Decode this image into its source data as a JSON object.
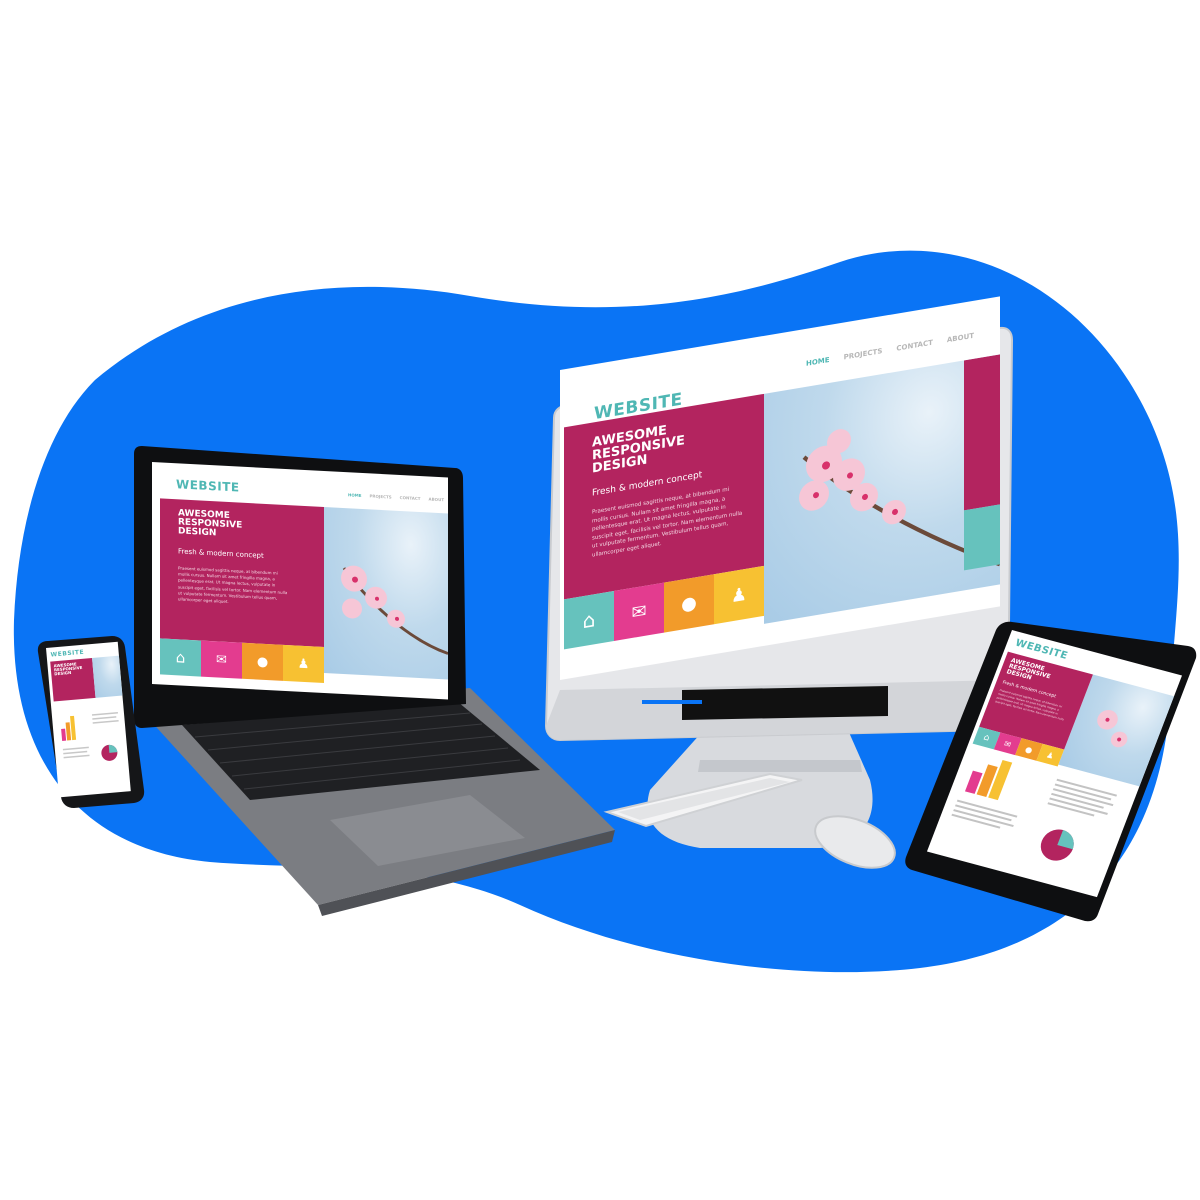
{
  "background": {
    "blob_color": "#0a74f5",
    "page_color": "#ffffff"
  },
  "website": {
    "brand": "WEBSITE",
    "nav": [
      "HOME",
      "PROJECTS",
      "CONTACT",
      "ABOUT"
    ],
    "headline_lines": [
      "AWESOME",
      "RESPONSIVE",
      "DESIGN"
    ],
    "tagline": "Fresh & modern concept",
    "body_lines": [
      "Praesent euismod sagittis neque, at bibendum mi",
      "mollis cursus. Nullam sit amet fringilla magna, a",
      "pellentesque erat. Ut magna lectus, vulputate in",
      "suscipit eget, facilisis vel tortor. Nam elementum nulla",
      "ut vulputate fermentum. Vestibulum tellus quam,",
      "ullamcorper eget aliquet."
    ],
    "tile_icons": [
      "home-icon",
      "mail-icon",
      "globe-icon",
      "person-icon"
    ],
    "colors": {
      "magenta": "#b3245f",
      "teal": "#66c2bd",
      "pink": "#e33c8f",
      "orange": "#f29b2a",
      "yellow": "#f7c132"
    }
  },
  "devices": [
    "laptop",
    "desktop-monitor",
    "tablet",
    "smartphone",
    "keyboard",
    "mouse"
  ]
}
